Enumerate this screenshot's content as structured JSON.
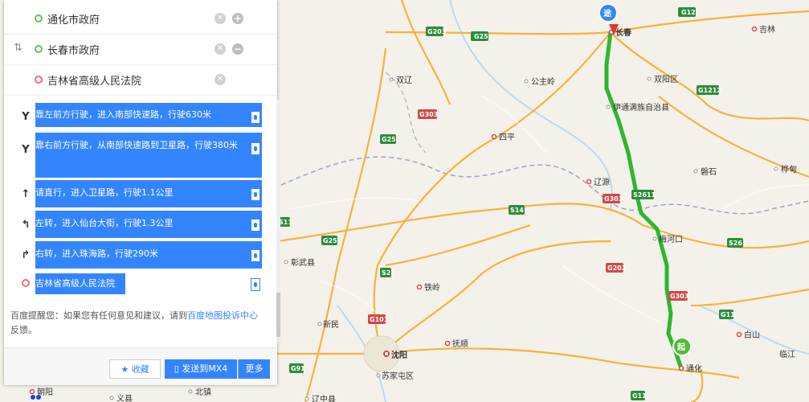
{
  "waypoints": [
    {
      "label": "通化市政府",
      "role": "start"
    },
    {
      "label": "长春市政府",
      "role": "via"
    },
    {
      "label": "吉林省高级人民法院",
      "role": "end"
    }
  ],
  "steps": [
    {
      "icon": "keep-left-icon",
      "glyph": "Y",
      "text": "靠左前方行驶，进入南部快速路，行驶630米"
    },
    {
      "icon": "keep-right-icon",
      "glyph": "Y",
      "text": "靠右前方行驶，从南部快速路到卫星路，行驶380米"
    },
    {
      "icon": "straight-icon",
      "glyph": "↑",
      "text": "请直行，进入卫星路，行驶1.1公里"
    },
    {
      "icon": "turn-left-icon",
      "glyph": "↰",
      "text": "左转，进入仙台大街，行驶1.3公里"
    },
    {
      "icon": "turn-right-icon",
      "glyph": "↱",
      "text": "右转，进入珠海路，行驶290米"
    },
    {
      "icon": "destination-dot-icon",
      "glyph": "",
      "text": "吉林省高级人民法院"
    }
  ],
  "tip": {
    "prefix": "百度提醒您：如果您有任何意见和建议，请到",
    "link": "百度地图投诉中心",
    "suffix": "反馈。"
  },
  "footer": {
    "favorite": "收藏",
    "send": "发送到MX4",
    "more": "更多"
  },
  "map": {
    "markers": {
      "start": "起",
      "via": "途"
    },
    "cities": [
      "长春",
      "吉林",
      "双辽",
      "公主岭",
      "双阳区",
      "伊通满族自治县",
      "四平",
      "辽源",
      "磐石",
      "桦甸",
      "梅河口",
      "彰武县",
      "铁岭",
      "新民",
      "沈阳",
      "抚顺",
      "苏家屯区",
      "白山",
      "临江",
      "通化",
      "朝阳",
      "义县",
      "北镇",
      "辽中县"
    ],
    "roads": [
      "G12",
      "G203",
      "G25",
      "G1212",
      "G303",
      "G25",
      "S2611",
      "S14",
      "G303",
      "S11",
      "G25",
      "G202",
      "S2",
      "S26",
      "G303",
      "G11",
      "G101",
      "G91",
      "G11"
    ],
    "colors": {
      "route": "#2cb82c",
      "highway": "#f7b23b",
      "water": "#bcd9f2",
      "land": "#f4f1ea",
      "accent": "#3385ff"
    }
  }
}
